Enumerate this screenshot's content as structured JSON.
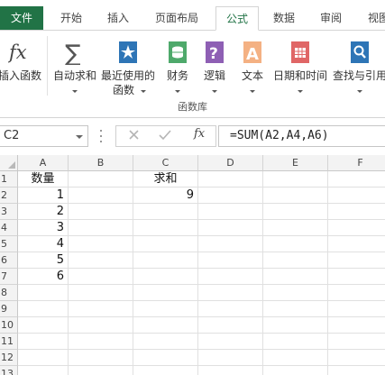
{
  "tabs": [
    {
      "label": "文件"
    },
    {
      "label": "开始"
    },
    {
      "label": "插入"
    },
    {
      "label": "页面布局"
    },
    {
      "label": "公式"
    },
    {
      "label": "数据"
    },
    {
      "label": "审阅"
    },
    {
      "label": "视图"
    }
  ],
  "active_tab": "公式",
  "ribbon": {
    "group_label": "函数库",
    "buttons": [
      {
        "label": "插入函数",
        "label2": ""
      },
      {
        "label": "自动求和",
        "label2": ""
      },
      {
        "label": "最近使用的",
        "label2": "函数"
      },
      {
        "label": "财务",
        "label2": ""
      },
      {
        "label": "逻辑",
        "label2": ""
      },
      {
        "label": "文本",
        "label2": ""
      },
      {
        "label": "日期和时间",
        "label2": ""
      },
      {
        "label": "查找与引用",
        "label2": ""
      }
    ]
  },
  "formula_bar": {
    "name_box": "C2",
    "fx_label": "fx",
    "formula": "=SUM(A2,A4,A6)"
  },
  "sheet": {
    "columns": [
      "A",
      "B",
      "C",
      "D",
      "E",
      "F"
    ],
    "rows": [
      "1",
      "2",
      "3",
      "4",
      "5",
      "6",
      "7",
      "8",
      "9",
      "10",
      "11",
      "12",
      "13"
    ],
    "cells": {
      "A1": "数量",
      "A2": "1",
      "A3": "2",
      "A4": "3",
      "A5": "4",
      "A6": "5",
      "A7": "6",
      "C1": "求和",
      "C2": "9"
    },
    "selected_cell": "C2"
  },
  "colors": {
    "accent": "#217346",
    "file_tab": "#217346"
  }
}
